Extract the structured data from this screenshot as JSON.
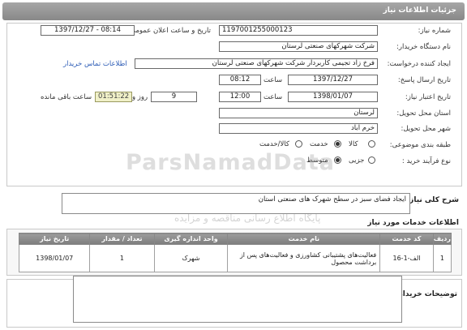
{
  "header": {
    "title": "جزئیات اطلاعات نیاز"
  },
  "form": {
    "need_number_label": "شماره نیاز:",
    "need_number": "1197001255000123",
    "announce_label": "تاریخ و ساعت اعلان عمومی:",
    "announce_value": "1397/12/27 - 08:14",
    "buyer_org_label": "نام دستگاه خریدار:",
    "buyer_org": "شرکت شهرکهای صنعتی لرستان",
    "creator_label": "ایجاد کننده درخواست:",
    "creator": "فرخ زاد تجیمی کاربردار شرکت شهرکهای صنعتی لرستان",
    "contact_link": "اطلاعات تماس خریدار",
    "answer_deadline_label": "تاریخ ارسال پاسخ:",
    "answer_date": "1397/12/27",
    "time_label": "ساعت",
    "answer_time": "08:12",
    "validity_label": "تاریخ اعتبار نیاز:",
    "validity_date": "1398/01/07",
    "validity_time": "12:00",
    "days_value": "9",
    "days_label": "روز و",
    "remaining_time": "01:51:22",
    "remaining_label": "ساعت باقی مانده",
    "province_label": "استان محل تحویل:",
    "province": "لرستان",
    "city_label": "شهر محل تحویل:",
    "city": "خرم آباد",
    "category_label": "طبقه بندی موضوعی:",
    "category_options": [
      "کالا",
      "خدمت",
      "کالا/خدمت"
    ],
    "category_selected": "خدمت",
    "process_label": "نوع فرآیند خرید :",
    "process_options": [
      "جزیی",
      "متوسط"
    ],
    "process_selected": "متوسط"
  },
  "summary": {
    "label": "شرح کلی نیاز:",
    "value": "ایجاد فضای سبز در سطح شهرک های صنعتی استان"
  },
  "services": {
    "title": "اطلاعات خدمات مورد نیاز",
    "headers": [
      "ردیف",
      "کد خدمت",
      "نام خدمت",
      "واحد اندازه گیری",
      "تعداد / مقدار",
      "تاریخ نیاز"
    ],
    "rows": [
      {
        "row": "1",
        "code": "الف-1-16",
        "name": "فعالیت‌های پشتیبانی کشاورزی و فعالیت‌های پس از برداشت محصول",
        "unit": "شهرک",
        "qty": "1",
        "date": "1398/01/07"
      }
    ]
  },
  "buyer_notes": {
    "label": "توضیحات خریدار:",
    "value": ""
  },
  "watermark": {
    "brand": "ParsNamadData",
    "tagline": "پایگاه اطلاع رسانی مناقصه و مزایده"
  }
}
